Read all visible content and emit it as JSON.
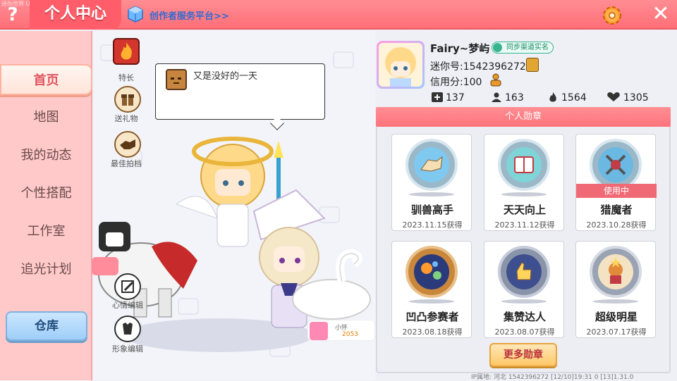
{
  "header": {
    "help_glyph": "?",
    "title": "个人中心",
    "watermark": "迷你世界 UID 1542396272",
    "creator_link": "创作者服务平台>>",
    "close_glyph": "✕"
  },
  "sidebar": {
    "items": [
      {
        "label": "首页",
        "active": true
      },
      {
        "label": "地图"
      },
      {
        "label": "我的动态"
      },
      {
        "label": "个性搭配"
      },
      {
        "label": "工作室"
      },
      {
        "label": "追光计划"
      }
    ],
    "warehouse": "仓库"
  },
  "center": {
    "actions": [
      {
        "label": "特长",
        "icon": "flame-emblem-icon"
      },
      {
        "label": "送礼物",
        "icon": "gift-icon"
      },
      {
        "label": "最佳拍档",
        "icon": "handshake-icon"
      }
    ],
    "bottom_actions": [
      {
        "label": "心情编辑",
        "icon": "pencil-icon"
      },
      {
        "label": "形象编辑",
        "icon": "outfit-icon"
      }
    ],
    "speech_text": "又是没好的一天",
    "pet_name": "小怀",
    "pet_score": "2053",
    "footer_info": "IP属地: 河北    1542396272    [12/10]19:31 0    [13]1.31.0"
  },
  "profile": {
    "nickname": "Fairy~梦屿",
    "sync_badge": "同步渠道实名",
    "mini_id": "迷你号:1542396272",
    "credit": "信用分:100",
    "stats": [
      {
        "icon": "plus-icon",
        "value": "137"
      },
      {
        "icon": "fans-icon",
        "value": "163"
      },
      {
        "icon": "fire-icon",
        "value": "1564"
      },
      {
        "icon": "heart-icon",
        "value": "1305"
      }
    ]
  },
  "badges": {
    "title": "个人勋章",
    "items": [
      {
        "name": "驯兽高手",
        "date": "2023.11.15获得",
        "icon": "horse-medal-icon",
        "in_use": false
      },
      {
        "name": "天天向上",
        "date": "2023.11.12获得",
        "icon": "book-medal-icon",
        "in_use": false
      },
      {
        "name": "猎魔者",
        "date": "2023.10.28获得",
        "icon": "swords-medal-icon",
        "in_use": true
      },
      {
        "name": "凹凸参赛者",
        "date": "2023.08.18获得",
        "icon": "planets-medal-icon",
        "in_use": false
      },
      {
        "name": "集赞达人",
        "date": "2023.08.07获得",
        "icon": "thumbs-up-medal-icon",
        "in_use": false
      },
      {
        "name": "超级明星",
        "date": "2023.07.17获得",
        "icon": "star-medal-icon",
        "in_use": false
      }
    ],
    "in_use_label": "使用中",
    "more_button": "更多勋章"
  },
  "colors": {
    "brand_pink": "#ff6f78",
    "active_nav_text": "#e0535e",
    "sync_green": "#39b48f",
    "more_button_text": "#b9313d"
  }
}
